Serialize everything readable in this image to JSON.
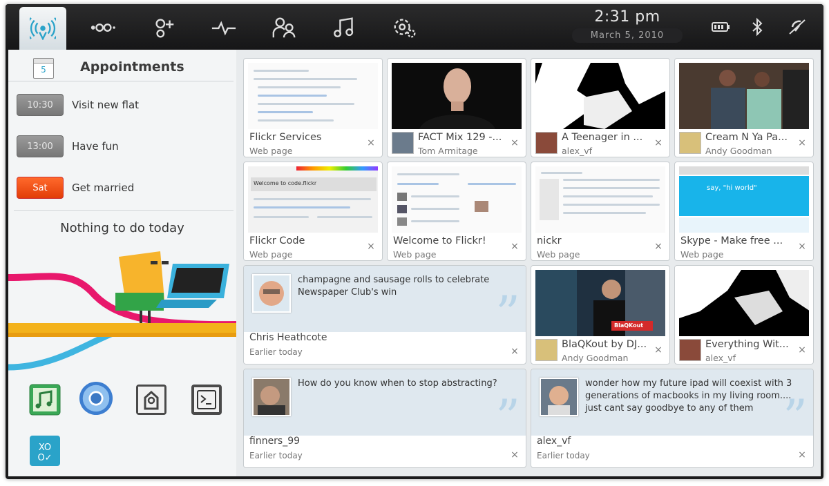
{
  "topbar": {
    "icons": [
      {
        "name": "myzone-icon"
      },
      {
        "name": "status-icon"
      },
      {
        "name": "people-icon"
      },
      {
        "name": "activity-icon"
      },
      {
        "name": "contacts-icon"
      },
      {
        "name": "music-icon"
      },
      {
        "name": "applications-icon"
      }
    ],
    "time": "2:31 pm",
    "date": "March  5, 2010",
    "status_icons": [
      "battery-icon",
      "bluetooth-icon",
      "network-icon"
    ]
  },
  "appointments": {
    "calendar_day": "5",
    "title": "Appointments",
    "items": [
      {
        "time": "10:30",
        "label": "Visit new flat",
        "highlight": false
      },
      {
        "time": "13:00",
        "label": "Have fun",
        "highlight": false
      },
      {
        "time": "Sat",
        "label": "Get married",
        "highlight": true
      }
    ]
  },
  "tasks": {
    "empty_text": "Nothing to do today"
  },
  "launchers": [
    "music-app-icon",
    "chrome-browser-icon",
    "settings-app-icon",
    "terminal-app-icon",
    "games-app-icon"
  ],
  "tiles": [
    {
      "title": "Flickr Services",
      "subtitle": "Web page"
    },
    {
      "title": "FACT Mix 129 -...",
      "subtitle": "Tom Armitage"
    },
    {
      "title": "A Teenager in ...",
      "subtitle": "alex_vf"
    },
    {
      "title": "Cream N Ya Pa...",
      "subtitle": "Andy Goodman"
    },
    {
      "title": "Flickr Code",
      "subtitle": "Web page"
    },
    {
      "title": "Welcome to Flickr!",
      "subtitle": "Web page"
    },
    {
      "title": "nickr",
      "subtitle": "Web page"
    },
    {
      "title": "Skype - Make free ...",
      "subtitle": "Web page"
    },
    {
      "title": "BlaQKout by DJ...",
      "subtitle": "Andy Goodman"
    },
    {
      "title": "Everything Wit...",
      "subtitle": "alex_vf"
    }
  ],
  "thumb_text": {
    "flickr_code_banner": "Welcome to code.flickr",
    "skype_banner": "say, \"hi world\"",
    "blaqkout_logo": "BlaQKout"
  },
  "posts": [
    {
      "text": "champagne and sausage rolls to celebrate Newspaper Club's win",
      "author": "Chris Heathcote",
      "time": "Earlier today"
    },
    {
      "text": "How do you know when to stop abstracting?",
      "author": "finners_99",
      "time": "Earlier today"
    },
    {
      "text": "wonder how my future ipad will coexist with 3 generations of macbooks in my living room.... just cant say goodbye to any of them",
      "author": "alex_vf",
      "time": "Earlier today"
    }
  ],
  "close_glyph": "×",
  "quote_glyph": "”"
}
